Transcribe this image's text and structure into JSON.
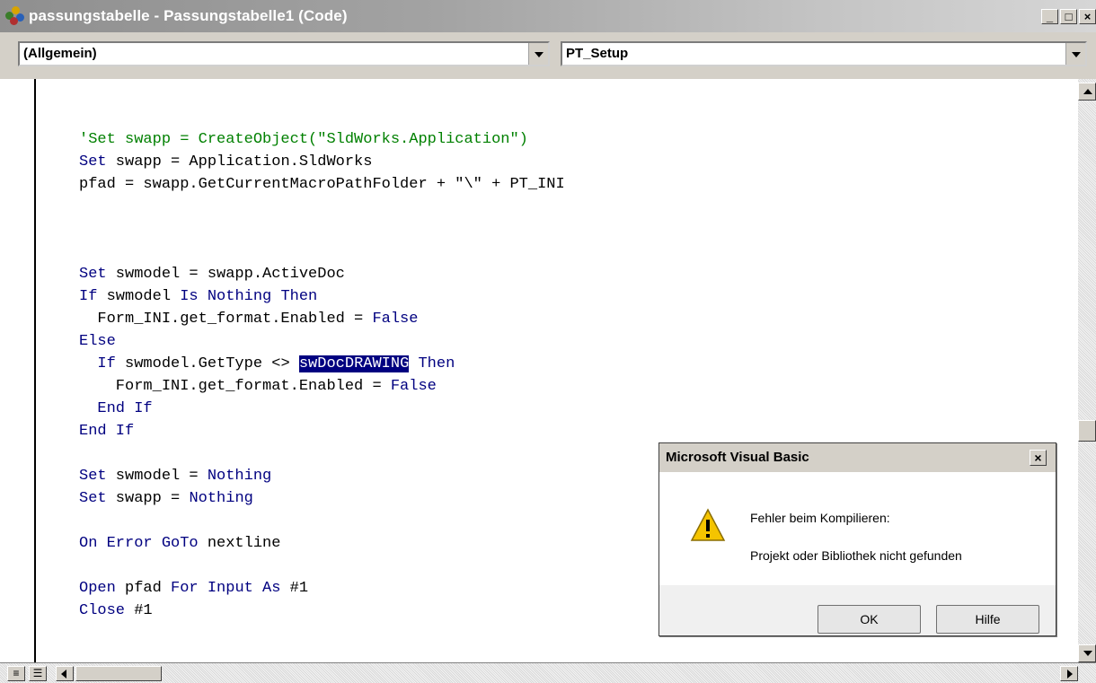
{
  "window": {
    "title": "passungstabelle - Passungstabelle1 (Code)",
    "minimize_label": "_",
    "maximize_label": "□",
    "close_label": "×"
  },
  "combos": {
    "object": "(Allgemein)",
    "procedure": "PT_Setup"
  },
  "code_lines": [
    "'Set swapp = CreateObject(\"SldWorks.Application\")",
    "Set swapp = Application.SldWorks",
    "pfad = swapp.GetCurrentMacroPathFolder + \"\\\" + PT_INI",
    "Set swmodel = swapp.ActiveDoc",
    "If swmodel Is Nothing Then",
    "  Form_INI.get_format.Enabled = False",
    "Else",
    "  If swmodel.GetType <> swDocDRAWING Then",
    "    Form_INI.get_format.Enabled = False",
    "  End If",
    "End If",
    "Set swmodel = Nothing",
    "Set swapp = Nothing",
    "On Error GoTo nextline",
    "Open pfad For Input As #1",
    "Close #1"
  ],
  "selected_token": "swDocDRAWING",
  "dialog": {
    "title": "Microsoft Visual Basic",
    "close_label": "×",
    "message_line1": "Fehler beim Kompilieren:",
    "message_line2": "Projekt oder Bibliothek nicht gefunden",
    "ok_label": "OK",
    "help_label": "Hilfe",
    "icon": "warning-icon"
  },
  "colors": {
    "keyword": "#000080",
    "comment": "#008000",
    "selection_bg": "#000080"
  }
}
